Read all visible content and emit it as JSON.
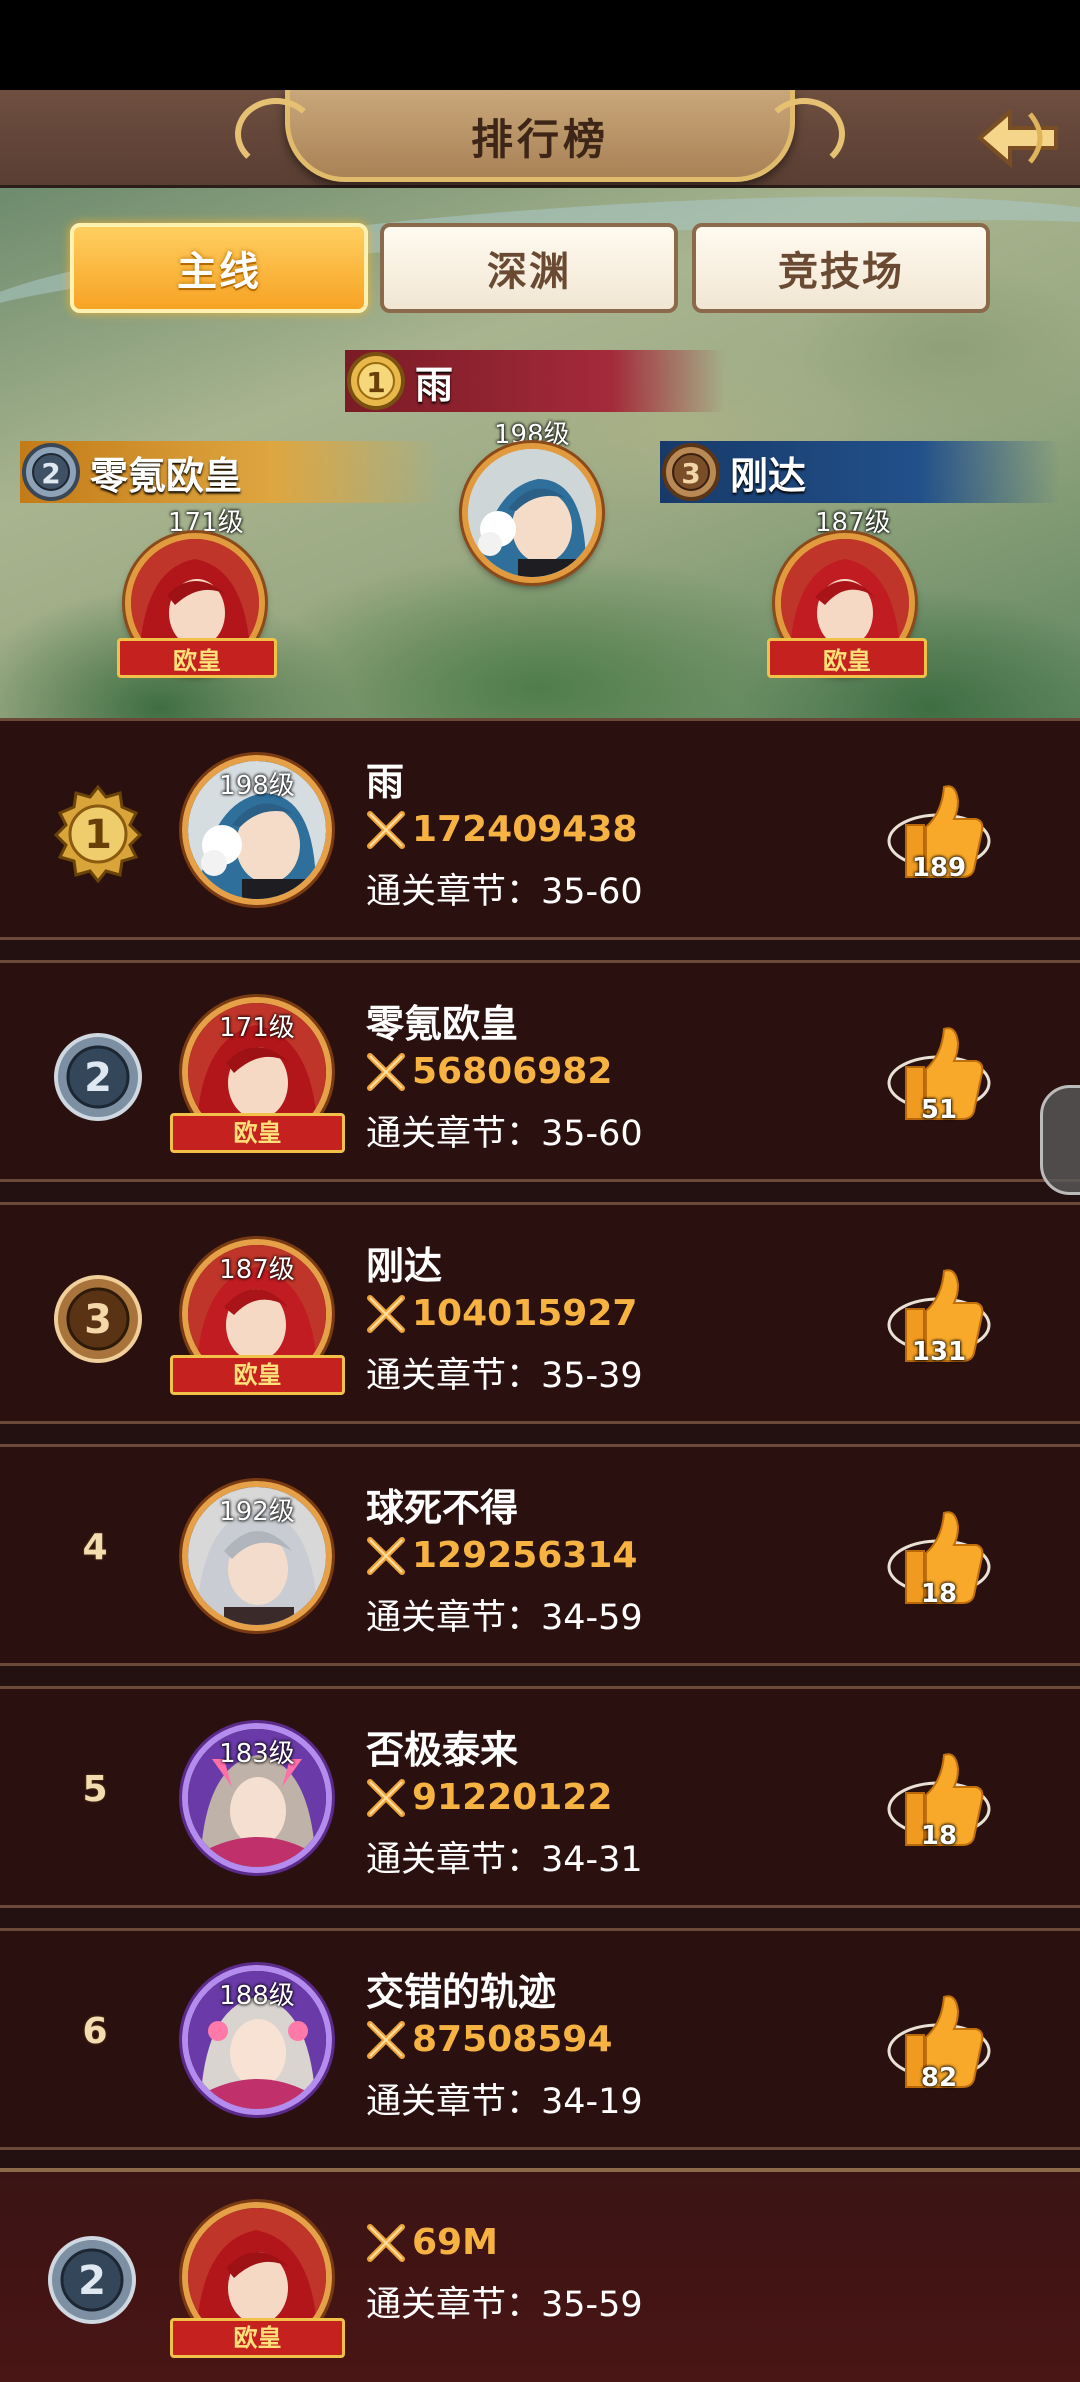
{
  "header": {
    "title": "排行榜"
  },
  "tabs": [
    {
      "label": "主线",
      "active": true
    },
    {
      "label": "深渊",
      "active": false
    },
    {
      "label": "竞技场",
      "active": false
    }
  ],
  "podium": {
    "first": {
      "rank": "1",
      "name": "雨",
      "level": "198级"
    },
    "second": {
      "rank": "2",
      "name": "零氪欧皇",
      "level": "171级",
      "badge": "欧皇"
    },
    "third": {
      "rank": "3",
      "name": "刚达",
      "level": "187级",
      "badge": "欧皇"
    }
  },
  "rows": [
    {
      "rank": "1",
      "level": "198级",
      "name": "雨",
      "power": "172409438",
      "chapter": "通关章节：35-60",
      "likes": "189"
    },
    {
      "rank": "2",
      "level": "171级",
      "badge": "欧皇",
      "name": "零氪欧皇",
      "power": "56806982",
      "chapter": "通关章节：35-60",
      "likes": "51"
    },
    {
      "rank": "3",
      "level": "187级",
      "badge": "欧皇",
      "name": "刚达",
      "power": "104015927",
      "chapter": "通关章节：35-39",
      "likes": "131"
    },
    {
      "rank": "4",
      "level": "192级",
      "name": "球死不得",
      "power": "129256314",
      "chapter": "通关章节：34-59",
      "likes": "18"
    },
    {
      "rank": "5",
      "level": "183级",
      "name": "否极泰来",
      "power": "91220122",
      "chapter": "通关章节：34-31",
      "likes": "18"
    },
    {
      "rank": "6",
      "level": "188级",
      "name": "交错的轨迹",
      "power": "87508594",
      "chapter": "通关章节：34-19",
      "likes": "82"
    }
  ],
  "self": {
    "rank": "2",
    "badge": "欧皇",
    "power": "69M",
    "chapter": "通关章节：35-59"
  },
  "colors": {
    "accent": "#f7b342",
    "tab_active": "#f7a324",
    "row_bg": "#2a1110",
    "gold": "#e5a048"
  }
}
